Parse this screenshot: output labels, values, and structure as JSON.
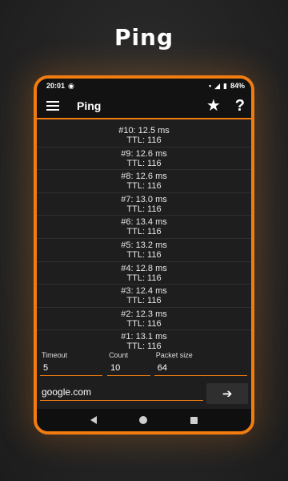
{
  "promo": {
    "title": "Ping"
  },
  "status": {
    "time": "20:01",
    "battery": "84%"
  },
  "appbar": {
    "title": "Ping"
  },
  "results": [
    {
      "line1": "#10: 12.5 ms",
      "line2": "TTL: 116"
    },
    {
      "line1": "#9: 12.6 ms",
      "line2": "TTL: 116"
    },
    {
      "line1": "#8: 12.6 ms",
      "line2": "TTL: 116"
    },
    {
      "line1": "#7: 13.0 ms",
      "line2": "TTL: 116"
    },
    {
      "line1": "#6: 13.4 ms",
      "line2": "TTL: 116"
    },
    {
      "line1": "#5: 13.2 ms",
      "line2": "TTL: 116"
    },
    {
      "line1": "#4: 12.8 ms",
      "line2": "TTL: 116"
    },
    {
      "line1": "#3: 12.4 ms",
      "line2": "TTL: 116"
    },
    {
      "line1": "#2: 12.3 ms",
      "line2": "TTL: 116"
    },
    {
      "line1": "#1: 13.1 ms",
      "line2": "TTL: 116"
    }
  ],
  "params": {
    "timeout_label": "Timeout",
    "timeout_value": "5",
    "count_label": "Count",
    "count_value": "10",
    "packet_label": "Packet size",
    "packet_value": "64"
  },
  "host": {
    "value": "google.com",
    "go_glyph": "➔"
  },
  "colors": {
    "accent": "#f07c12",
    "background": "#1e1e1e",
    "bar": "#121212"
  },
  "icons": [
    "menu-icon",
    "star-icon",
    "help-icon",
    "arrow-right-icon",
    "nav-back-icon",
    "nav-home-icon",
    "nav-recent-icon"
  ]
}
